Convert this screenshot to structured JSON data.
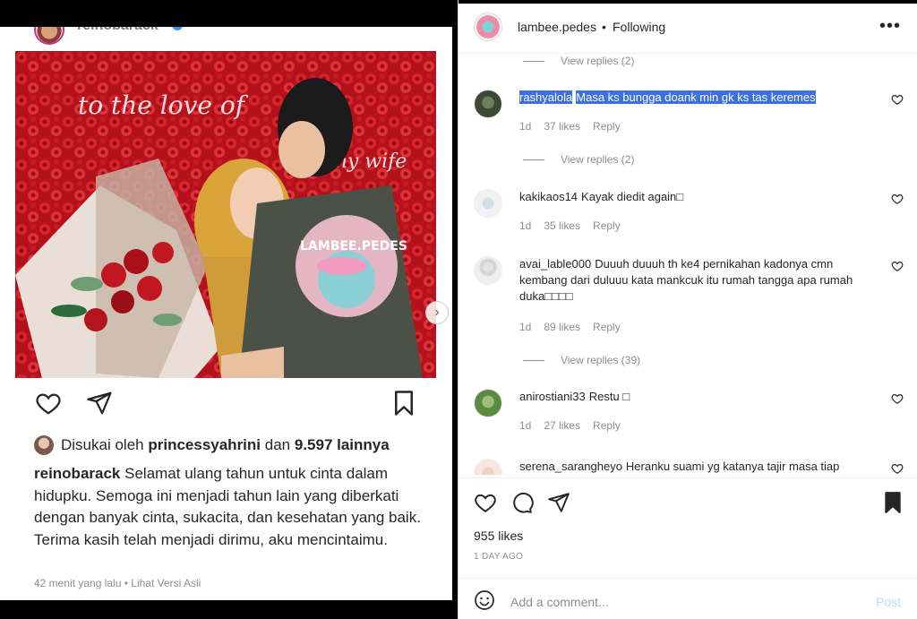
{
  "left_post": {
    "username": "reinobarack",
    "watermark": "LAMBEE.PEDES",
    "photo_overlay_text": "to the love of",
    "photo_overlay_text_2": "my wife",
    "liked_prefix": "Disukai oleh",
    "liked_user": "princessyahrini",
    "liked_and": "dan",
    "liked_count": "9.597 lainnya",
    "caption_user": "reinobarack",
    "caption_text": "Selamat ulang tahun untuk cinta dalam hidupku. Semoga ini menjadi tahun lain yang diberkati dengan banyak cinta, sukacita, dan kesehatan yang baik. Terima kasih telah menjadi dirimu, aku mencintaimu.",
    "time": "42 menit yang lalu",
    "separator": "•",
    "original_link": "Lihat Versi Asli",
    "icons": {
      "like": "heart-icon",
      "share": "send-icon",
      "save": "bookmark-icon"
    }
  },
  "panel": {
    "header": {
      "username": "lambee.pedes",
      "dot": "•",
      "following": "Following",
      "more": "•••"
    },
    "comments": [
      {
        "type": "replies",
        "label": "View replies (2)"
      },
      {
        "type": "comment",
        "user": "rashyalola",
        "text": "Masa ks bungga doank min gk ks tas keremes",
        "time": "1d",
        "likes": "37 likes",
        "reply": "Reply",
        "highlighted": true
      },
      {
        "type": "replies",
        "label": "View replies (2)"
      },
      {
        "type": "comment",
        "user": "kakikaos14",
        "text": "Kayak diedit again□",
        "time": "1d",
        "likes": "35 likes",
        "reply": "Reply"
      },
      {
        "type": "comment",
        "user": "avai_lable000",
        "text": "Duuuh duuuh th ke4 pernikahan kadonya cmn kembang dari duluuu kata mankcuk itu rumah tangga apa rumah duka□□□□",
        "time": "1d",
        "likes": "89 likes",
        "reply": "Reply"
      },
      {
        "type": "replies",
        "label": "View replies (39)"
      },
      {
        "type": "comment",
        "user": "anirostiani33",
        "text": "Restu □",
        "time": "1d",
        "likes": "27 likes",
        "reply": "Reply"
      },
      {
        "type": "comment",
        "user": "serena_sarangheyo",
        "text": "Heranku suami yg katanya tajir masa tiap"
      }
    ],
    "likes": "955 likes",
    "date": "1 DAY AGO",
    "add_comment_placeholder": "Add a comment...",
    "post_label": "Post",
    "icons": {
      "like": "heart-icon",
      "comment": "comment-icon",
      "share": "send-icon",
      "save": "bookmark-filled-icon",
      "emoji": "emoji-icon"
    }
  }
}
